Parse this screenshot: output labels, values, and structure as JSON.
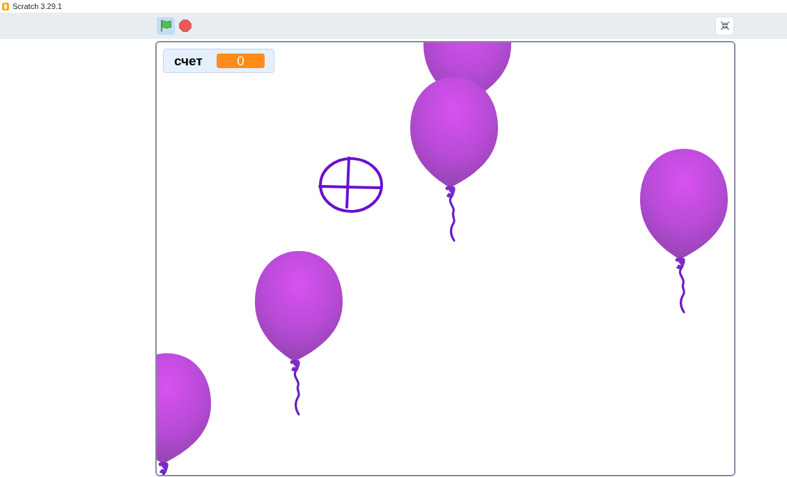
{
  "window": {
    "title": "Scratch 3.29.1"
  },
  "toolbar": {
    "green_flag": {
      "active": true
    }
  },
  "stage": {
    "monitors": [
      {
        "label": "счет",
        "value": "0"
      }
    ]
  }
}
